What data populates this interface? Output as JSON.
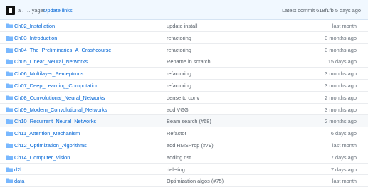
{
  "commit": {
    "author": "a .  …  уager",
    "message": "Update links",
    "info": "Latest commit 618f1fb 5 days ago"
  },
  "icon_color": "#79b8ff",
  "rows": [
    {
      "name": "Ch02_Installation",
      "message": "update install",
      "age": "last month"
    },
    {
      "name": "Ch03_Introduction",
      "message": "refactoring",
      "age": "3 months ago"
    },
    {
      "name": "Ch04_The_Preliminaries_A_Crashcourse",
      "message": "refactoring",
      "age": "3 months ago"
    },
    {
      "name": "Ch05_Linear_Neural_Networks",
      "message": "Rename in scratch",
      "age": "15 days ago"
    },
    {
      "name": "Ch06_Multilayer_Perceptrons",
      "message": "refactoring",
      "age": "3 months ago"
    },
    {
      "name": "Ch07_Deep_Learning_Computation",
      "message": "refactoring",
      "age": "3 months ago"
    },
    {
      "name": "Ch08_Convolutional_Neural_Networks",
      "message": "dense to conv",
      "age": "2 months ago"
    },
    {
      "name": "Ch09_Modern_Convolutional_Networks",
      "message": "add VGG",
      "age": "3 months ago"
    },
    {
      "name": "Ch10_Recurrent_Neural_Networks",
      "message": "Beam search (#68)",
      "age": "2 months ago"
    },
    {
      "name": "Ch11_Attention_Mechanism",
      "message": "Refactor",
      "age": "6 days ago"
    },
    {
      "name": "Ch12_Optimization_Algorithms",
      "message": "add RMSProp (#79)",
      "age": "last month"
    },
    {
      "name": "Ch14_Computer_Vision",
      "message": "adding nst",
      "age": "7 days ago"
    },
    {
      "name": "d2l",
      "message": "deleting",
      "age": "7 days ago"
    },
    {
      "name": "data",
      "message": "Optimization algos (#75)",
      "age": "last month"
    }
  ]
}
